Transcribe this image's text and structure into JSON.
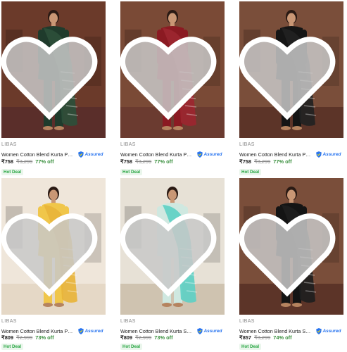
{
  "products": [
    {
      "brand": "LIBAS",
      "title": "Women Cotton Blend Kurta Pant ...",
      "assured_label": "Assured",
      "price": "₹758",
      "mrp": "₹3,299",
      "discount": "77% off",
      "deal": "Hot Deal",
      "wishlist_icon": "heart-icon",
      "colors": {
        "bg": "#6b3a2a",
        "outfit": "#1f3b2c",
        "dupatta": "#2d4f3a",
        "floor": "#5a2e2a"
      }
    },
    {
      "brand": "LIBAS",
      "title": "Women Cotton Blend Kurta Pant ...",
      "assured_label": "Assured",
      "price": "₹758",
      "mrp": "₹3,299",
      "discount": "77% off",
      "deal": "Hot Deal",
      "wishlist_icon": "heart-icon",
      "colors": {
        "bg": "#7a4a36",
        "outfit": "#8b1a22",
        "dupatta": "#9c2630",
        "floor": "#6b3b30"
      }
    },
    {
      "brand": "LIBAS",
      "title": "Women Cotton Blend Kurta Pant ...",
      "assured_label": "Assured",
      "price": "₹758",
      "mrp": "₹3,299",
      "discount": "77% off",
      "deal": "Hot Deal",
      "wishlist_icon": "heart-icon",
      "colors": {
        "bg": "#7a4e3a",
        "outfit": "#151515",
        "dupatta": "#222222",
        "floor": "#5c3428"
      }
    },
    {
      "brand": "LIBAS",
      "title": "Women Cotton Blend Kurta Pala...",
      "assured_label": "Assured",
      "price": "₹809",
      "mrp": "₹2,999",
      "discount": "73% off",
      "deal": "Hot Deal",
      "wishlist_icon": "heart-icon",
      "colors": {
        "bg": "#efe6da",
        "outfit": "#f0c64a",
        "dupatta": "#e8b43a",
        "floor": "#e5d8c6"
      }
    },
    {
      "brand": "LIBAS",
      "title": "Women Cotton Blend Kurta Salw...",
      "assured_label": "Assured",
      "price": "₹809",
      "mrp": "₹2,999",
      "discount": "73% off",
      "deal": "Hot Deal",
      "wishlist_icon": "heart-icon",
      "colors": {
        "bg": "#e7e1d6",
        "outfit": "#cfe8e0",
        "dupatta": "#5fd0c4",
        "floor": "#cfc3b0"
      }
    },
    {
      "brand": "LIBAS",
      "title": "Women Cotton Blend Kurta Salw...",
      "assured_label": "Assured",
      "price": "₹857",
      "mrp": "₹3,299",
      "discount": "74% off",
      "deal": "Hot Deal",
      "wishlist_icon": "heart-icon",
      "colors": {
        "bg": "#7a4e3a",
        "outfit": "#141414",
        "dupatta": "#1e1e1e",
        "floor": "#5c3428"
      }
    }
  ]
}
